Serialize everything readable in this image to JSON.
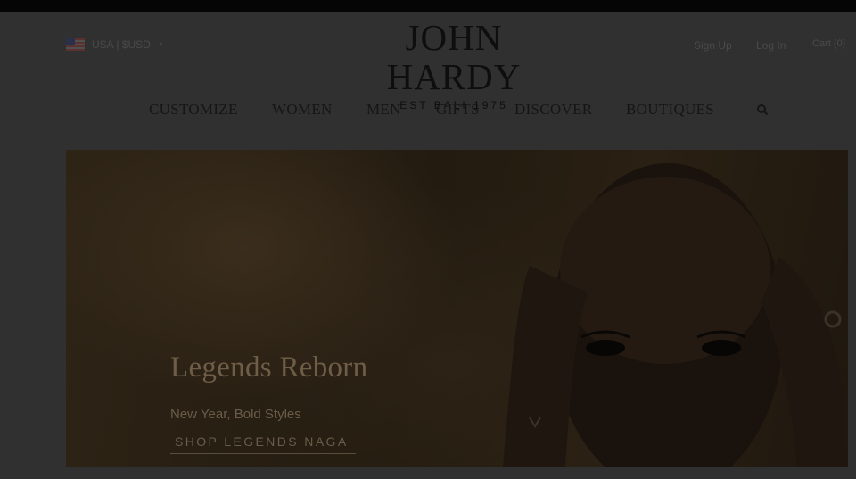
{
  "header": {
    "locale_label": "USA | $USD",
    "logo_brand": "JOHN HARDY",
    "logo_tagline": "EST BALI 1975",
    "sign_up": "Sign Up",
    "log_in": "Log In",
    "cart": "Cart (0)"
  },
  "nav": {
    "items": [
      {
        "label": "CUSTOMIZE"
      },
      {
        "label": "WOMEN"
      },
      {
        "label": "MEN"
      },
      {
        "label": "GIFTS"
      },
      {
        "label": "DISCOVER"
      },
      {
        "label": "BOUTIQUES"
      }
    ],
    "search_icon": "search-icon"
  },
  "hero": {
    "title": "Legends Reborn",
    "subtitle": "New Year, Bold Styles",
    "cta": "SHOP LEGENDS NAGA"
  },
  "icons": {
    "flag": "us-flag-icon",
    "chevron": "chevron-right-icon"
  }
}
